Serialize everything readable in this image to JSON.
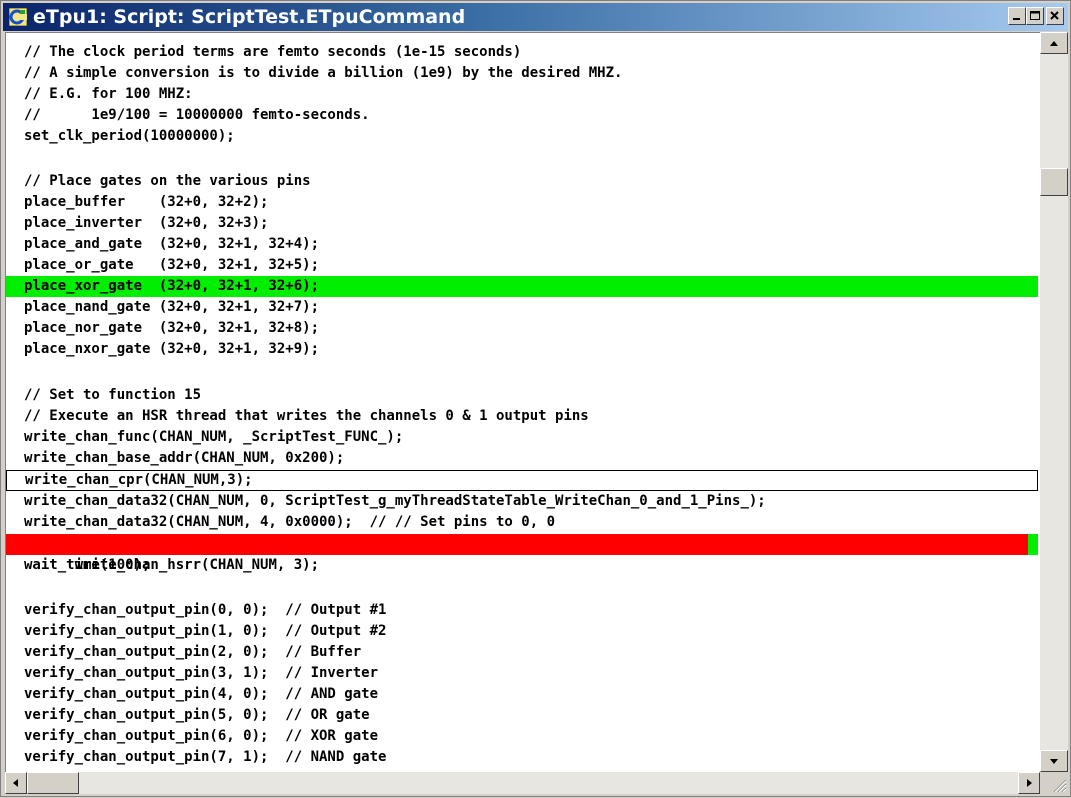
{
  "window": {
    "title": "eTpu1: Script: ScriptTest.ETpuCommand",
    "app_icon": "etpu-app-icon",
    "controls": [
      "minimize-icon",
      "maximize-icon",
      "close-icon"
    ]
  },
  "editor": {
    "lines": [
      "// The clock period terms are femto seconds (1e-15 seconds)",
      "// A simple conversion is to divide a billion (1e9) by the desired MHZ.",
      "// E.G. for 100 MHZ:",
      "//      1e9/100 = 10000000 femto-seconds.",
      "set_clk_period(10000000);",
      "",
      "// Place gates on the various pins",
      "place_buffer    (32+0, 32+2);",
      "place_inverter  (32+0, 32+3);",
      "place_and_gate  (32+0, 32+1, 32+4);",
      "place_or_gate   (32+0, 32+1, 32+5);",
      "place_xor_gate  (32+0, 32+1, 32+6);",
      "place_nand_gate (32+0, 32+1, 32+7);",
      "place_nor_gate  (32+0, 32+1, 32+8);",
      "place_nxor_gate (32+0, 32+1, 32+9);",
      "",
      "// Set to function 15",
      "// Execute an HSR thread that writes the channels 0 & 1 output pins",
      "write_chan_func(CHAN_NUM, _ScriptTest_FUNC_);",
      "write_chan_base_addr(CHAN_NUM, 0x200);",
      "write_chan_cpr(CHAN_NUM,3);",
      "write_chan_data32(CHAN_NUM, 0, ScriptTest_g_myThreadStateTable_WriteChan_0_and_1_Pins_);",
      "write_chan_data32(CHAN_NUM, 4, 0x0000);  // // Set pins to 0, 0",
      "write_chan_hsrr(CHAN_NUM, 3);",
      "wait_time(100);",
      "",
      "verify_chan_output_pin(0, 0);  // Output #1",
      "verify_chan_output_pin(1, 0);  // Output #2",
      "verify_chan_output_pin(2, 0);  // Buffer",
      "verify_chan_output_pin(3, 1);  // Inverter",
      "verify_chan_output_pin(4, 0);  // AND gate",
      "verify_chan_output_pin(5, 0);  // OR gate",
      "verify_chan_output_pin(6, 0);  // XOR gate",
      "verify_chan_output_pin(7, 1);  // NAND gate"
    ],
    "highlight_colors": {
      "breakpoint": "#00ee00",
      "current": "#ff0000"
    }
  },
  "scrollbars": {
    "vertical": {
      "position": 0.17
    },
    "horizontal": {
      "position": 0.0
    }
  }
}
